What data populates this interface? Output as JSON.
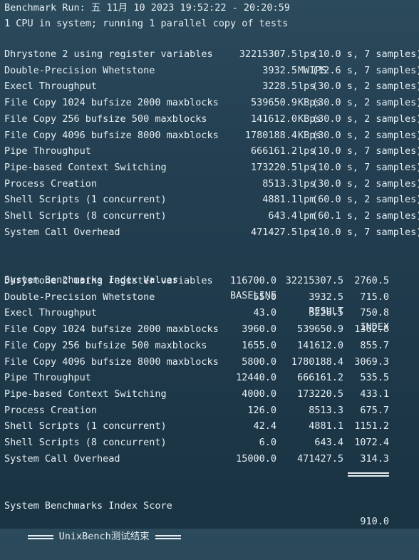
{
  "header": {
    "run_line": "Benchmark Run: 五 11月 10 2023 19:52:22 - 20:20:59",
    "cpu_line": "1 CPU in system; running 1 parallel copy of tests"
  },
  "results": [
    {
      "name": "Dhrystone 2 using register variables",
      "value": "32215307.5",
      "unit": "lps",
      "detail": "(10.0 s, 7 samples)"
    },
    {
      "name": "Double-Precision Whetstone",
      "value": "3932.5",
      "unit": "MWIPS",
      "detail": "(12.6 s, 7 samples)"
    },
    {
      "name": "Execl Throughput",
      "value": "3228.5",
      "unit": "lps",
      "detail": "(30.0 s, 2 samples)"
    },
    {
      "name": "File Copy 1024 bufsize 2000 maxblocks",
      "value": "539650.9",
      "unit": "KBps",
      "detail": "(30.0 s, 2 samples)"
    },
    {
      "name": "File Copy 256 bufsize 500 maxblocks",
      "value": "141612.0",
      "unit": "KBps",
      "detail": "(30.0 s, 2 samples)"
    },
    {
      "name": "File Copy 4096 bufsize 8000 maxblocks",
      "value": "1780188.4",
      "unit": "KBps",
      "detail": "(30.0 s, 2 samples)"
    },
    {
      "name": "Pipe Throughput",
      "value": "666161.2",
      "unit": "lps",
      "detail": "(10.0 s, 7 samples)"
    },
    {
      "name": "Pipe-based Context Switching",
      "value": "173220.5",
      "unit": "lps",
      "detail": "(10.0 s, 7 samples)"
    },
    {
      "name": "Process Creation",
      "value": "8513.3",
      "unit": "lps",
      "detail": "(30.0 s, 2 samples)"
    },
    {
      "name": "Shell Scripts (1 concurrent)",
      "value": "4881.1",
      "unit": "lpm",
      "detail": "(60.0 s, 2 samples)"
    },
    {
      "name": "Shell Scripts (8 concurrent)",
      "value": "643.4",
      "unit": "lpm",
      "detail": "(60.1 s, 2 samples)"
    },
    {
      "name": "System Call Overhead",
      "value": "471427.5",
      "unit": "lps",
      "detail": "(10.0 s, 7 samples)"
    }
  ],
  "index_table": {
    "title": "System Benchmarks Index Values",
    "col_baseline": "BASELINE",
    "col_result": "RESULT",
    "col_index": "INDEX",
    "rows": [
      {
        "name": "Dhrystone 2 using register variables",
        "baseline": "116700.0",
        "result": "32215307.5",
        "index": "2760.5"
      },
      {
        "name": "Double-Precision Whetstone",
        "baseline": "55.0",
        "result": "3932.5",
        "index": "715.0"
      },
      {
        "name": "Execl Throughput",
        "baseline": "43.0",
        "result": "3228.5",
        "index": "750.8"
      },
      {
        "name": "File Copy 1024 bufsize 2000 maxblocks",
        "baseline": "3960.0",
        "result": "539650.9",
        "index": "1362.8"
      },
      {
        "name": "File Copy 256 bufsize 500 maxblocks",
        "baseline": "1655.0",
        "result": "141612.0",
        "index": "855.7"
      },
      {
        "name": "File Copy 4096 bufsize 8000 maxblocks",
        "baseline": "5800.0",
        "result": "1780188.4",
        "index": "3069.3"
      },
      {
        "name": "Pipe Throughput",
        "baseline": "12440.0",
        "result": "666161.2",
        "index": "535.5"
      },
      {
        "name": "Pipe-based Context Switching",
        "baseline": "4000.0",
        "result": "173220.5",
        "index": "433.1"
      },
      {
        "name": "Process Creation",
        "baseline": "126.0",
        "result": "8513.3",
        "index": "675.7"
      },
      {
        "name": "Shell Scripts (1 concurrent)",
        "baseline": "42.4",
        "result": "4881.1",
        "index": "1151.2"
      },
      {
        "name": "Shell Scripts (8 concurrent)",
        "baseline": "6.0",
        "result": "643.4",
        "index": "1072.4"
      },
      {
        "name": "System Call Overhead",
        "baseline": "15000.0",
        "result": "471427.5",
        "index": "314.3"
      }
    ],
    "score_label": "System Benchmarks Index Score",
    "score_value": "910.0"
  },
  "footer": {
    "text": "UnixBench测试结束"
  }
}
